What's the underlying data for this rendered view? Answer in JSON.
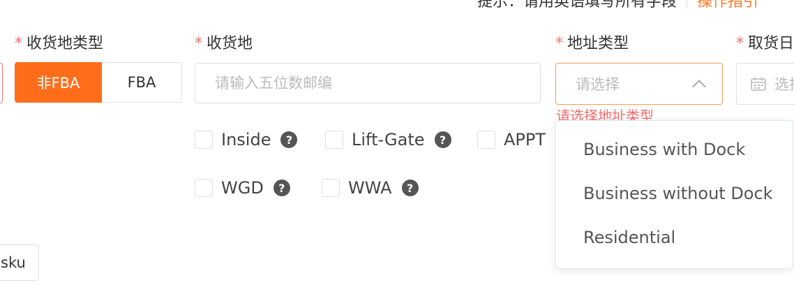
{
  "top_note": {
    "hint": "提示：请用英语填写所有字段",
    "guide_link": "操作指引"
  },
  "fields": {
    "destination_type": {
      "required_mark": "*",
      "label": "收货地类型",
      "options": [
        "非FBA",
        "FBA"
      ],
      "selected": "非FBA"
    },
    "destination": {
      "required_mark": "*",
      "label": "收货地",
      "placeholder": "请输入五位数邮编",
      "value": ""
    },
    "address_type": {
      "required_mark": "*",
      "label": "地址类型",
      "placeholder": "请选择",
      "error": "请选择地址类型",
      "options": [
        "Business with Dock",
        "Business without Dock",
        "Residential"
      ]
    },
    "pickup_date": {
      "required_mark": "*",
      "label": "取货日",
      "placeholder": "选择"
    }
  },
  "services": [
    {
      "label": "Inside",
      "checked": false,
      "has_help": true
    },
    {
      "label": "Lift-Gate",
      "checked": false,
      "has_help": true
    },
    {
      "label": "APPT",
      "checked": false,
      "has_help": false
    },
    {
      "label": "WGD",
      "checked": false,
      "has_help": true
    },
    {
      "label": "WWA",
      "checked": false,
      "has_help": true
    }
  ],
  "help_glyph": "?",
  "sku_button": "sku",
  "colors": {
    "primary": "#ff6d1b",
    "error": "#f56c6c",
    "focus_border": "#ff9a52"
  },
  "icons": [
    "help-icon",
    "chevron-up-icon",
    "calendar-icon"
  ]
}
